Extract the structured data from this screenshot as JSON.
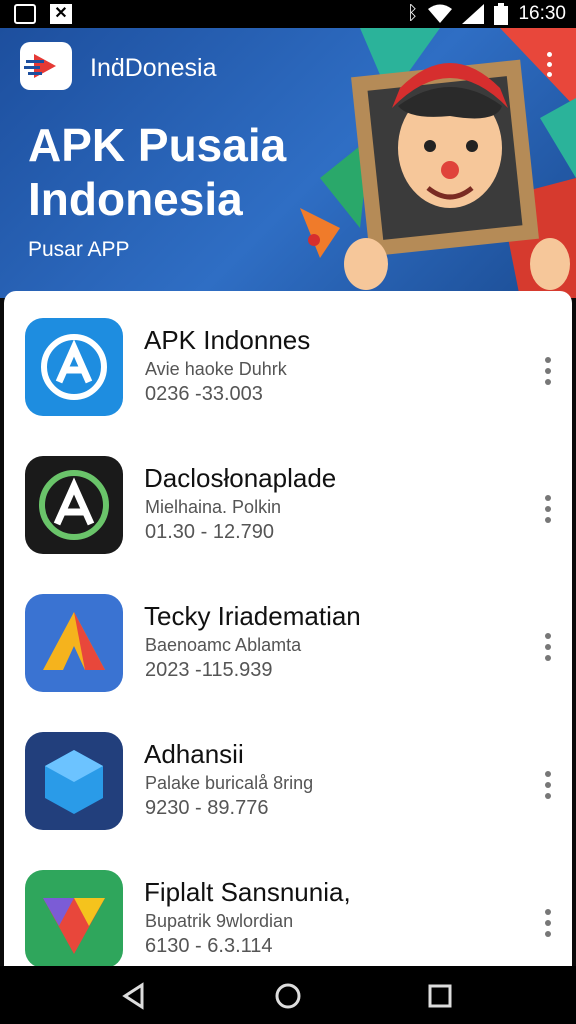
{
  "status_bar": {
    "time": "16:30",
    "left_icons": [
      "image-notification-icon",
      "x-notification-icon"
    ],
    "right_icons": [
      "bluetooth-icon",
      "wifi-icon",
      "signal-icon",
      "battery-icon"
    ]
  },
  "header": {
    "brand": "InḋDonesia",
    "title": "APK Pusaia Indonesia",
    "subtitle": "Pusar APP",
    "background_color": "#2a62b4"
  },
  "apps": [
    {
      "name": "APK Indonnes",
      "developer": "Avie haoke Duhrk",
      "meta": "0236 -33.003",
      "icon": "blue-a-circle-icon",
      "color": "#1e8de0"
    },
    {
      "name": "Daclosłonaplade",
      "developer": "Mielhaina. Polkin",
      "meta": "01.30 - 12.790",
      "icon": "dark-a-ring-icon",
      "color": "#1a1a1a"
    },
    {
      "name": "Tecky Iriadematian",
      "developer": "Baenoamc Ablamta",
      "meta": "2023 -115.939",
      "icon": "colorful-a-icon",
      "color": "#3a73d2"
    },
    {
      "name": "Adhansii",
      "developer": "Palake buricalå 8ring",
      "meta": "9230 - 89.776",
      "icon": "blue-cube-icon",
      "color": "#223f7c"
    },
    {
      "name": "Fiplalt Sansnunia,",
      "developer": "Bupatrik 9wlordian",
      "meta": "6130 - 6.3.114",
      "icon": "green-gem-icon",
      "color": "#2fa65c"
    }
  ],
  "nav": {
    "buttons": [
      "back-icon",
      "home-icon",
      "recents-icon"
    ]
  }
}
